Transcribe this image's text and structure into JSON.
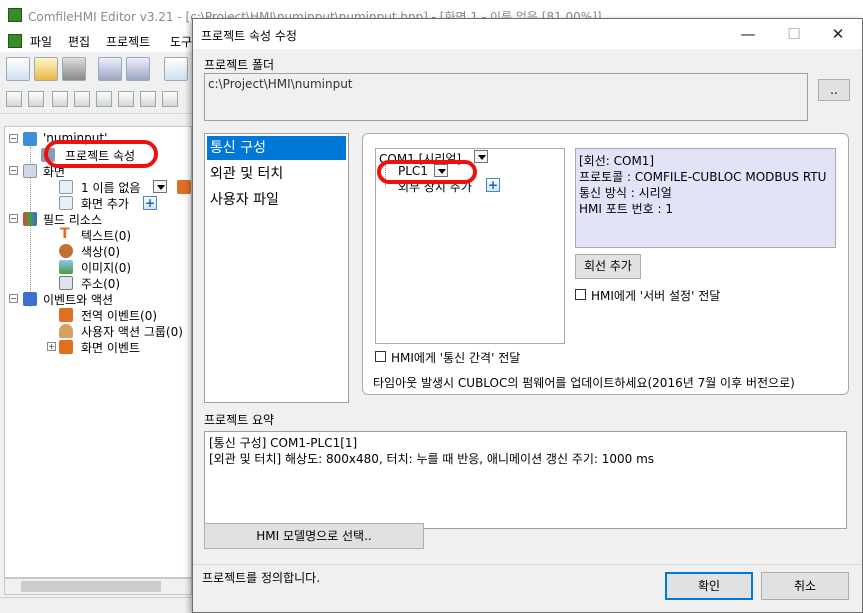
{
  "editor": {
    "title": "ComfileHMI Editor v3.21 - [c:\\Project\\HMI\\numinput\\numinput.hnp] - [화면 1 - 이름 없음 [81.00%]]",
    "menu": [
      "파일",
      "편집",
      "프로젝트",
      "도구"
    ],
    "tree": {
      "root": "'numinput'",
      "project_properties": "프로젝트 속성",
      "screens": "화면",
      "screen1": "1 이름 없음",
      "add_screen": "화면 추가",
      "field_resources": "필드 리소스",
      "text": "텍스트(0)",
      "color": "색상(0)",
      "image": "이미지(0)",
      "address": "주소(0)",
      "events_actions": "이벤트와 액션",
      "global_events": "전역 이벤트(0)",
      "user_action_groups": "사용자 액션 그룹(0)",
      "screen_events": "화면 이벤트"
    }
  },
  "dialog": {
    "title": "프로젝트 속성 수정",
    "folder_label": "프로젝트 폴더",
    "folder_path": "c:\\Project\\HMI\\numinput",
    "browse_label": "..",
    "nav": [
      "통신 구성",
      "외관 및 터치",
      "사용자 파일"
    ],
    "nav_selected": 0,
    "comm_tree": {
      "port": "COM1 [시리얼]",
      "plc": "PLC1",
      "add_device": "외부 장치 추가"
    },
    "info": [
      "[회선: COM1]",
      "프로토콜 : COMFILE-CUBLOC MODBUS RTU",
      "통신 방식 : 시리얼",
      "HMI 포트 번호 : 1"
    ],
    "add_line_label": "회선 추가",
    "server_settings_label": "HMI에게 '서버 설정' 전달",
    "comm_interval_label": "HMI에게 '통신 간격' 전달",
    "timeout_note": "타임아웃 발생시 CUBLOC의 펌웨어를 업데이트하세요(2016년 7월 이후 버전으로)",
    "summary_label": "프로젝트 요약",
    "summary_lines": [
      "[통신 구성] COM1-PLC1[1]",
      "[외관 및 터치]  해상도: 800x480,  터치: 누를 때 반응, 애니메이션 갱신 주기: 1000 ms"
    ],
    "model_select_label": "HMI 모델명으로 선택..",
    "status_text": "프로젝트를 정의합니다.",
    "ok_label": "확인",
    "cancel_label": "취소",
    "caption_buttons": {
      "minimize": "—",
      "maximize": "☐",
      "close": "✕"
    }
  },
  "colors": {
    "selection": "#0078d7",
    "info_bg": "#e3e3f8",
    "annotation_red": "#ee1010",
    "accent_icon": "#1a5fb4"
  }
}
